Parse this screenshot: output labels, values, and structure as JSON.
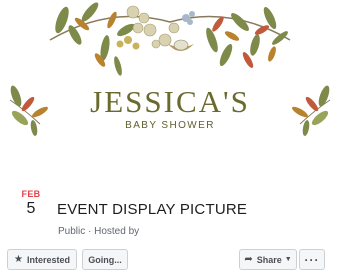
{
  "cover": {
    "title": "JESSICA'S",
    "subtitle": "BABY SHOWER"
  },
  "event": {
    "month": "FEB",
    "day": "5",
    "title": "EVENT DISPLAY PICTURE",
    "meta": "Public · Hosted by"
  },
  "actions": {
    "interested": "Interested",
    "going": "Going...",
    "share": "Share",
    "more": "···"
  },
  "icons": {
    "interested": "star-icon",
    "share": "share-arrow-icon",
    "share_caret": "caret-down-icon"
  },
  "colors": {
    "month_accent": "#e3434b",
    "cover_text": "#6b6a2e",
    "button_bg": "#f5f6f7",
    "button_border": "#ccd0d5"
  }
}
